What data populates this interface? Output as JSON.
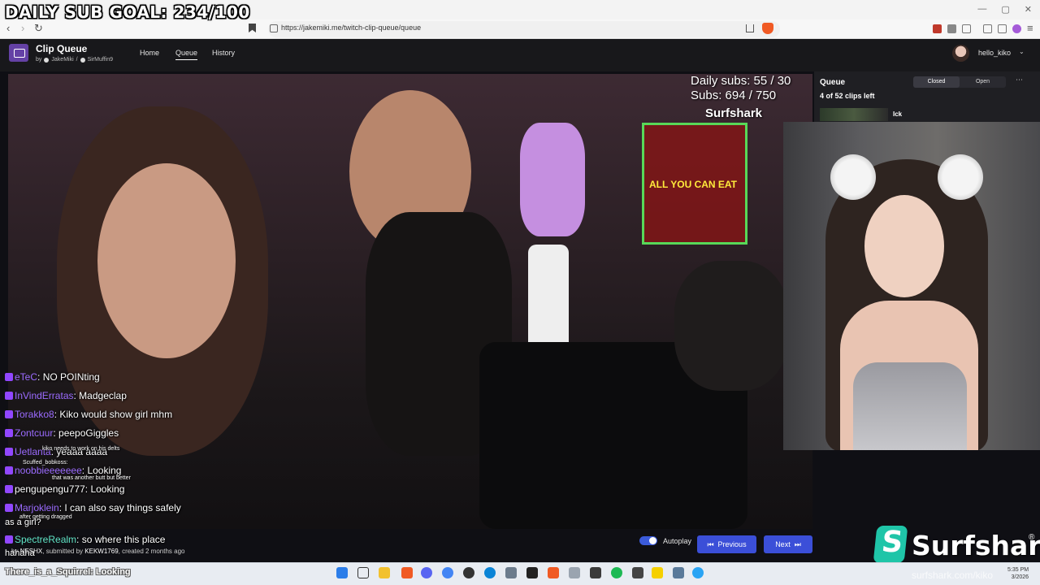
{
  "overlays": {
    "daily_goal": "DAILY SUB GOAL: 234/100",
    "squirrel": "There_is_a_Squirrel: Looking",
    "hahaha": "hahaha"
  },
  "browser": {
    "url": "https://jakemiki.me/twitch-clip-queue/queue"
  },
  "app": {
    "title": "Clip Queue",
    "by": "by",
    "author1": "JakeMiki",
    "sep": "/",
    "author2": "SirMuffin9",
    "nav": [
      "Home",
      "Queue",
      "History"
    ],
    "username": "hello_kiko"
  },
  "video_overlay": {
    "daily_subs": "Daily subs: 55 / 30",
    "subs": "Subs: 694 / 750",
    "surfshark": "Surfshark",
    "sign_text": "ALL YOU CAN EAT"
  },
  "chat": [
    {
      "user": "eTeC",
      "msg": "NO POINting"
    },
    {
      "user": "InVindErratas",
      "msg": "Madgeclap"
    },
    {
      "user": "Torakko8",
      "msg": "Kiko would show girl mhm"
    },
    {
      "user": "Zontcuur",
      "msg": "peepoGiggles"
    },
    {
      "user": "Uetlanta",
      "msg": "yeaaa aaaa"
    },
    {
      "user": "noobbieeeeeee",
      "msg": "Looking"
    },
    {
      "user": "pengupengu777",
      "msg": "Looking"
    },
    {
      "user": "Marjoklein",
      "msg": "I can also say things safely"
    },
    {
      "user": "SpectreRealm",
      "msg": "so where this place"
    }
  ],
  "chat_small": {
    "line1": "kiko needs to work on his delts",
    "line2": "Scuffed_bobkoss:",
    "line3": "that was another butt but better",
    "line4": "after getting dragged",
    "line5": "as a girl?"
  },
  "clip": {
    "info_prefix": "by",
    "clip_author": "NESHX",
    "submitted_by_label": ", submitted by",
    "submitter": "KEKW1769",
    "created": ", created 2 months ago"
  },
  "controls": {
    "autoplay_label": "Autoplay",
    "autoplay_on": true,
    "previous": "Previous",
    "next": "Next"
  },
  "queue": {
    "title": "Queue",
    "remaining": "4 of 52 clips left",
    "tab_closed": "Closed",
    "tab_open": "Open",
    "menu": "⋯",
    "first_item_title": "Ick"
  },
  "sponsor": {
    "name": "Surfshark",
    "reg": "®",
    "url": "surfshark.com/kiko"
  },
  "taskbar": {
    "time": "5:35 PM",
    "date": "3/2026"
  },
  "colors": {
    "accent": "#3b4fd8",
    "app_bg": "#18181b",
    "twitch_purple": "#6441a5",
    "surfshark": "#1fc5a8"
  }
}
